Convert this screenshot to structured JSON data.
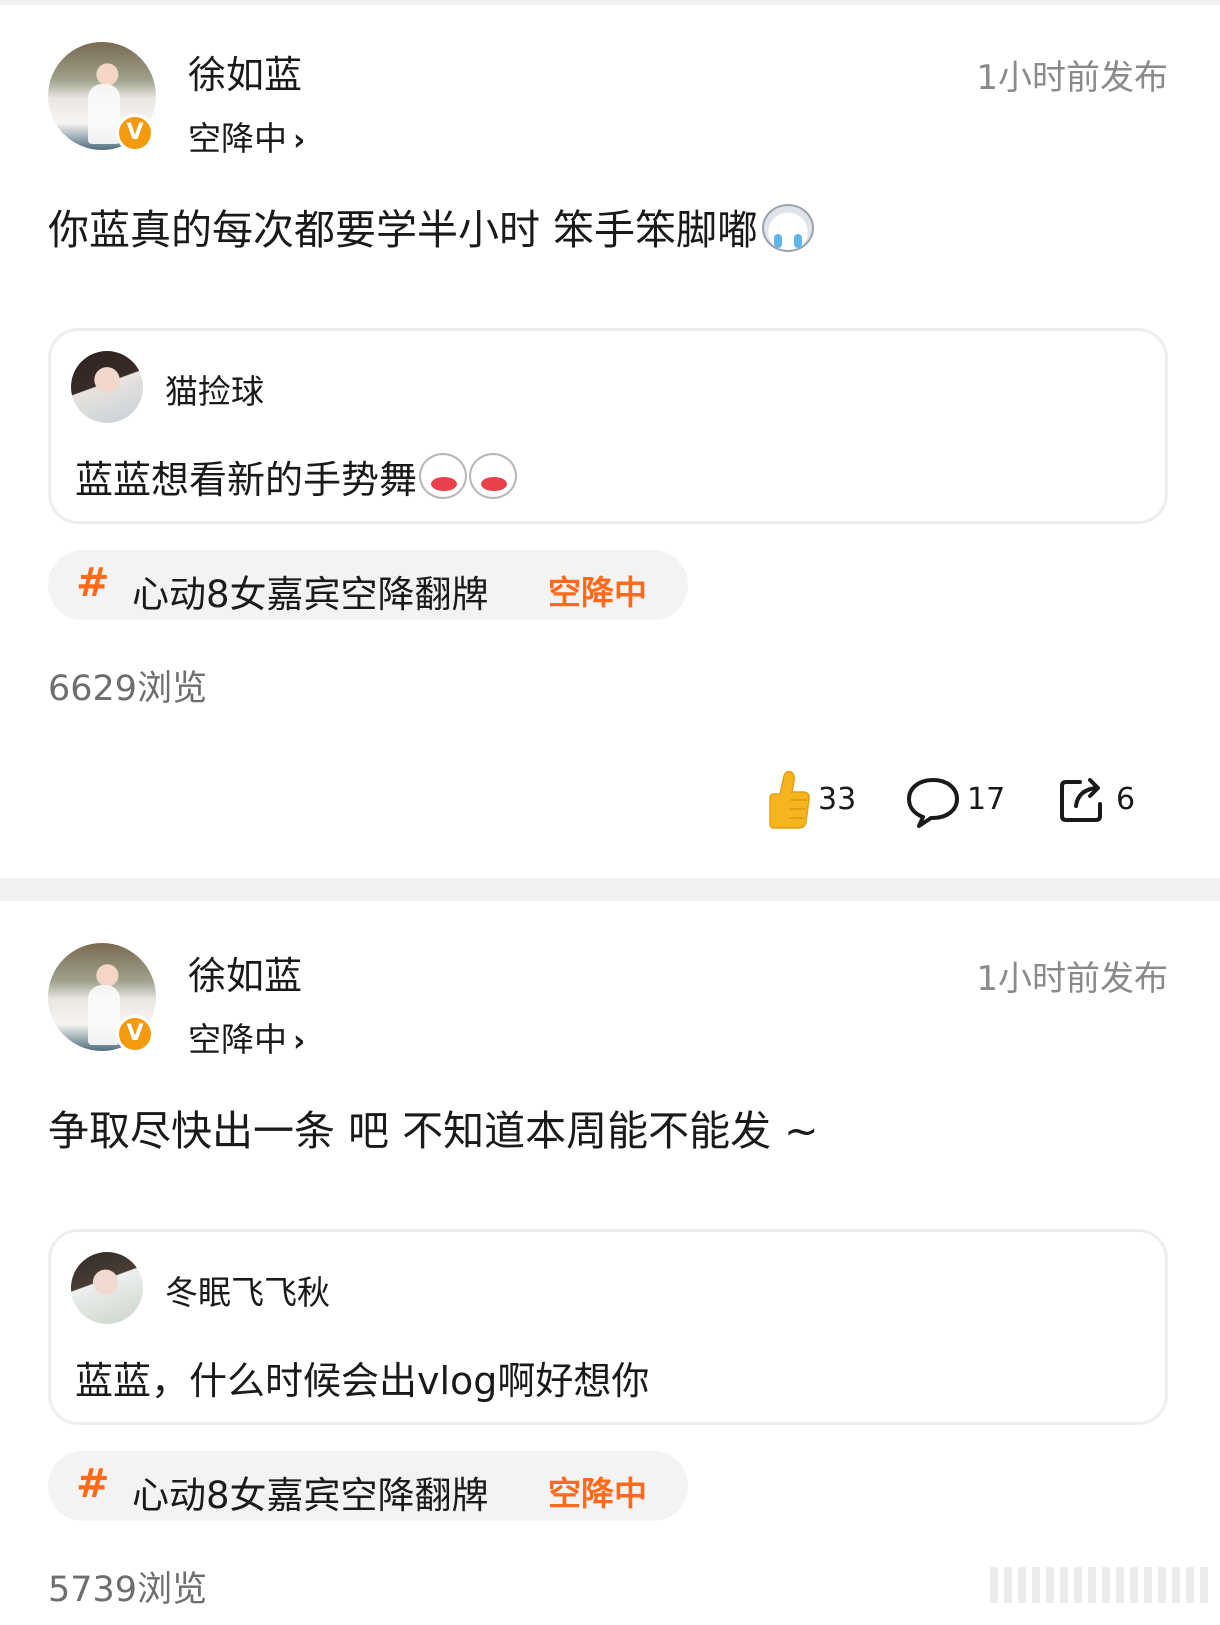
{
  "posts": [
    {
      "author": "徐如蓝",
      "status": "空降中",
      "time": "1小时前发布",
      "text": "你蓝真的每次都要学半小时 笨手笨脚嘟",
      "text_emoji": "crying-face",
      "quote": {
        "user": "猫捡球",
        "text": "蓝蓝想看新的手势舞"
      },
      "topic": {
        "hash": "#",
        "title": "心动8女嘉宾空降翻牌",
        "flag": "空降中"
      },
      "views": "6629浏览",
      "actions": {
        "likes": "33",
        "comments": "17",
        "shares": "6"
      }
    },
    {
      "author": "徐如蓝",
      "status": "空降中",
      "time": "1小时前发布",
      "text": "争取尽快出一条 吧 不知道本周能不能发 ~",
      "quote": {
        "user": "冬眠飞飞秋",
        "text": "蓝蓝，什么时候会出vlog啊好想你"
      },
      "topic": {
        "hash": "#",
        "title": "心动8女嘉宾空降翻牌",
        "flag": "空降中"
      },
      "views": "5739浏览"
    }
  ],
  "ui": {
    "chevron": "›",
    "verified_mark": "V"
  },
  "colors": {
    "accent": "#ff6a1a",
    "verified": "#f39a0f",
    "divider": "#f1f1f1",
    "muted": "#8a8a8a"
  }
}
